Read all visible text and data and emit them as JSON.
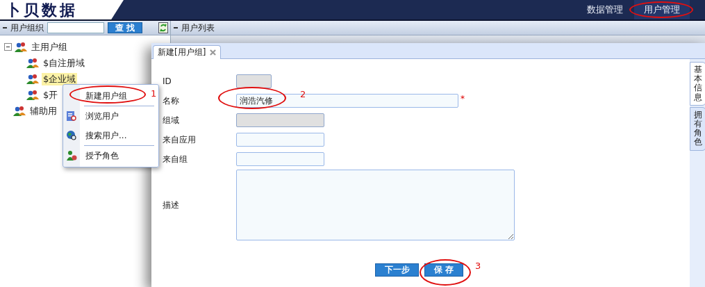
{
  "header": {
    "logo": "卜贝数据",
    "nav": [
      {
        "label": "数据管理",
        "selected": false
      },
      {
        "label": "用户管理",
        "selected": true
      }
    ]
  },
  "left_panel": {
    "title": "用户组织",
    "search_button": "查 找",
    "tree": [
      {
        "label": "主用户组",
        "expanded": true,
        "selected": false,
        "children": [
          {
            "label": "$自注册域",
            "selected": false
          },
          {
            "label": "$企业域",
            "selected": true
          },
          {
            "label": "$开",
            "selected": false
          }
        ]
      },
      {
        "label": "辅助用",
        "selected": false
      }
    ]
  },
  "list_panel": {
    "title": "用户列表"
  },
  "context_menu": {
    "groups": [
      {
        "items": [
          "新建用户组"
        ]
      },
      {
        "items": [
          "浏览用户",
          "搜索用户..."
        ]
      },
      {
        "items": [
          "授予角色"
        ]
      }
    ]
  },
  "dialog": {
    "tab": "新建[用户组]",
    "fields": [
      {
        "label": "ID",
        "kind": "short",
        "disabled": true,
        "required": false
      },
      {
        "label": "名称",
        "kind": "long",
        "disabled": false,
        "required": true,
        "value": "润浩汽修"
      },
      {
        "label": "组域",
        "kind": "medium",
        "disabled": true,
        "required": false
      },
      {
        "label": "来自应用",
        "kind": "medium",
        "disabled": false,
        "required": false
      },
      {
        "label": "来自组",
        "kind": "medium",
        "disabled": false,
        "required": false
      },
      {
        "label": "描述",
        "kind": "textarea",
        "disabled": false,
        "required": false
      }
    ],
    "required_mark": "*",
    "buttons": [
      "下一步",
      "保 存"
    ],
    "side_tabs": [
      {
        "label": "基本信息",
        "selected": true
      },
      {
        "label": "拥有角色",
        "selected": false
      }
    ]
  },
  "annotations": [
    "1",
    "2",
    "3"
  ]
}
